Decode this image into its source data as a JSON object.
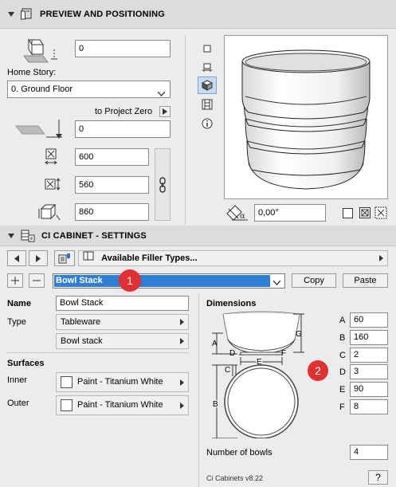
{
  "preview_panel": {
    "title": "PREVIEW AND POSITIONING",
    "elevation_value": "0",
    "home_story_label": "Home Story:",
    "home_story_value": "0. Ground Floor",
    "to_project_zero_label": "to Project Zero",
    "project_zero_value": "0",
    "width_value": "600",
    "depth_value": "560",
    "height_value": "860",
    "angle_value": "0,00°"
  },
  "settings_panel": {
    "title": "CI CABINET - SETTINGS",
    "filler_types_label": "Available Filler Types...",
    "selected_item": "Bowl Stack",
    "copy_label": "Copy",
    "paste_label": "Paste",
    "callout_1": "1",
    "callout_2": "2",
    "name_label": "Name",
    "name_value": "Bowl Stack",
    "type_label": "Type",
    "type_value_1": "Tableware",
    "type_value_2": "Bowl stack",
    "surfaces_label": "Surfaces",
    "inner_label": "Inner",
    "inner_value": "Paint - Titanium White",
    "outer_label": "Outer",
    "outer_value": "Paint - Titanium White",
    "dimensions_label": "Dimensions",
    "dimensions": [
      {
        "key": "A",
        "value": "60"
      },
      {
        "key": "B",
        "value": "160"
      },
      {
        "key": "C",
        "value": "2"
      },
      {
        "key": "D",
        "value": "3"
      },
      {
        "key": "E",
        "value": "90"
      },
      {
        "key": "F",
        "value": "8"
      }
    ],
    "diagram_labels": {
      "a": "A",
      "b": "B",
      "c": "C",
      "d": "D",
      "e": "E",
      "f": "F",
      "g": "G"
    },
    "number_of_bowls_label": "Number of bowls",
    "number_of_bowls_value": "4",
    "version_label": "Ci Cabinets v8.22",
    "help_label": "?"
  },
  "colors": {
    "selection_blue": "#2f7fd8",
    "callout_red": "#e03030"
  }
}
